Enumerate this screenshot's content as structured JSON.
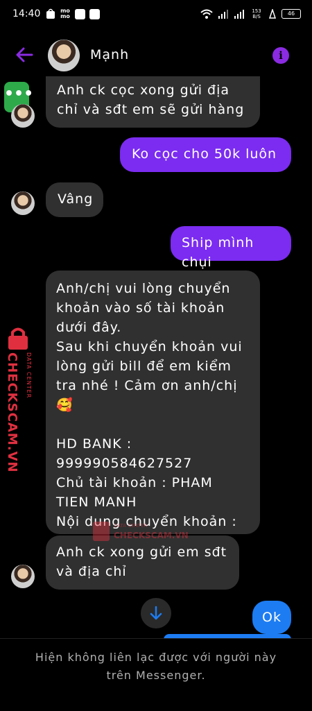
{
  "status_bar": {
    "time": "14:40",
    "app_icon_text": "mo mo",
    "net_speed": "153 B/S",
    "battery": "46"
  },
  "header": {
    "contact_name": "Mạnh",
    "info_icon": "info-icon",
    "back_icon": "back-arrow-icon"
  },
  "messages": [
    {
      "side": "received",
      "text": "Anh ck cọc xong gửi địa\nchỉ và sđt em sẽ gửi hàng"
    },
    {
      "side": "sent",
      "text": "Ko cọc cho 50k luôn"
    },
    {
      "side": "received",
      "text": "Vâng"
    },
    {
      "side": "sent",
      "text": "Ship mình chụi"
    },
    {
      "side": "received",
      "text": "Anh/chị vui lòng chuyển\nkhoản vào số tài khoản\ndưới đây.\nSau khi chuyển khoản vui\nlòng gửi bill để em kiểm\ntra nhé ! Cảm ơn anh/chị\n🥰\n\nHD BANK :\n999990584627527\nChủ tài khoản : PHAM\nTIEN MANH\nNội dung chuyển khoản :"
    },
    {
      "side": "received",
      "text": "Anh ck xong gửi em sđt\nvà địa chỉ"
    },
    {
      "side": "sent",
      "text": "Ok"
    }
  ],
  "watermark": {
    "brand": "CHECKSCAM.VN",
    "sub": "DATA CENTER"
  },
  "chat_head_label": "•••",
  "footer": {
    "notice": "Hiện không liên lạc được với người này\ntrên Messenger."
  },
  "colors": {
    "sent_bubble": "#7b2cf0",
    "received_bubble": "#303030",
    "accent": "#8a2be2",
    "ok_bubble": "#1d7cf2"
  }
}
